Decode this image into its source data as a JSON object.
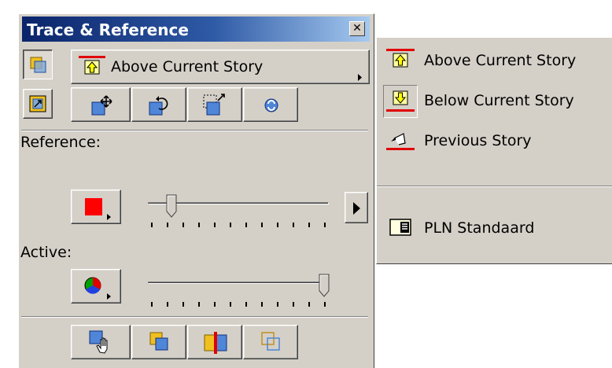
{
  "palette": {
    "title": "Trace & Reference",
    "close_glyph": "✕",
    "story_selector": "Above Current Story",
    "reference_label": "Reference:",
    "active_label": "Active:",
    "reference_color": "#ff0000",
    "reference_level": 0.12,
    "active_level": 1.0
  },
  "menu": {
    "items": [
      {
        "label": "Above Current Story",
        "icon": "above-story-icon"
      },
      {
        "label": "Below Current Story",
        "icon": "below-story-icon"
      },
      {
        "label": "Previous Story",
        "icon": "previous-story-icon"
      },
      {
        "label": "PLN Standaard",
        "icon": "plan-view-icon"
      }
    ]
  }
}
